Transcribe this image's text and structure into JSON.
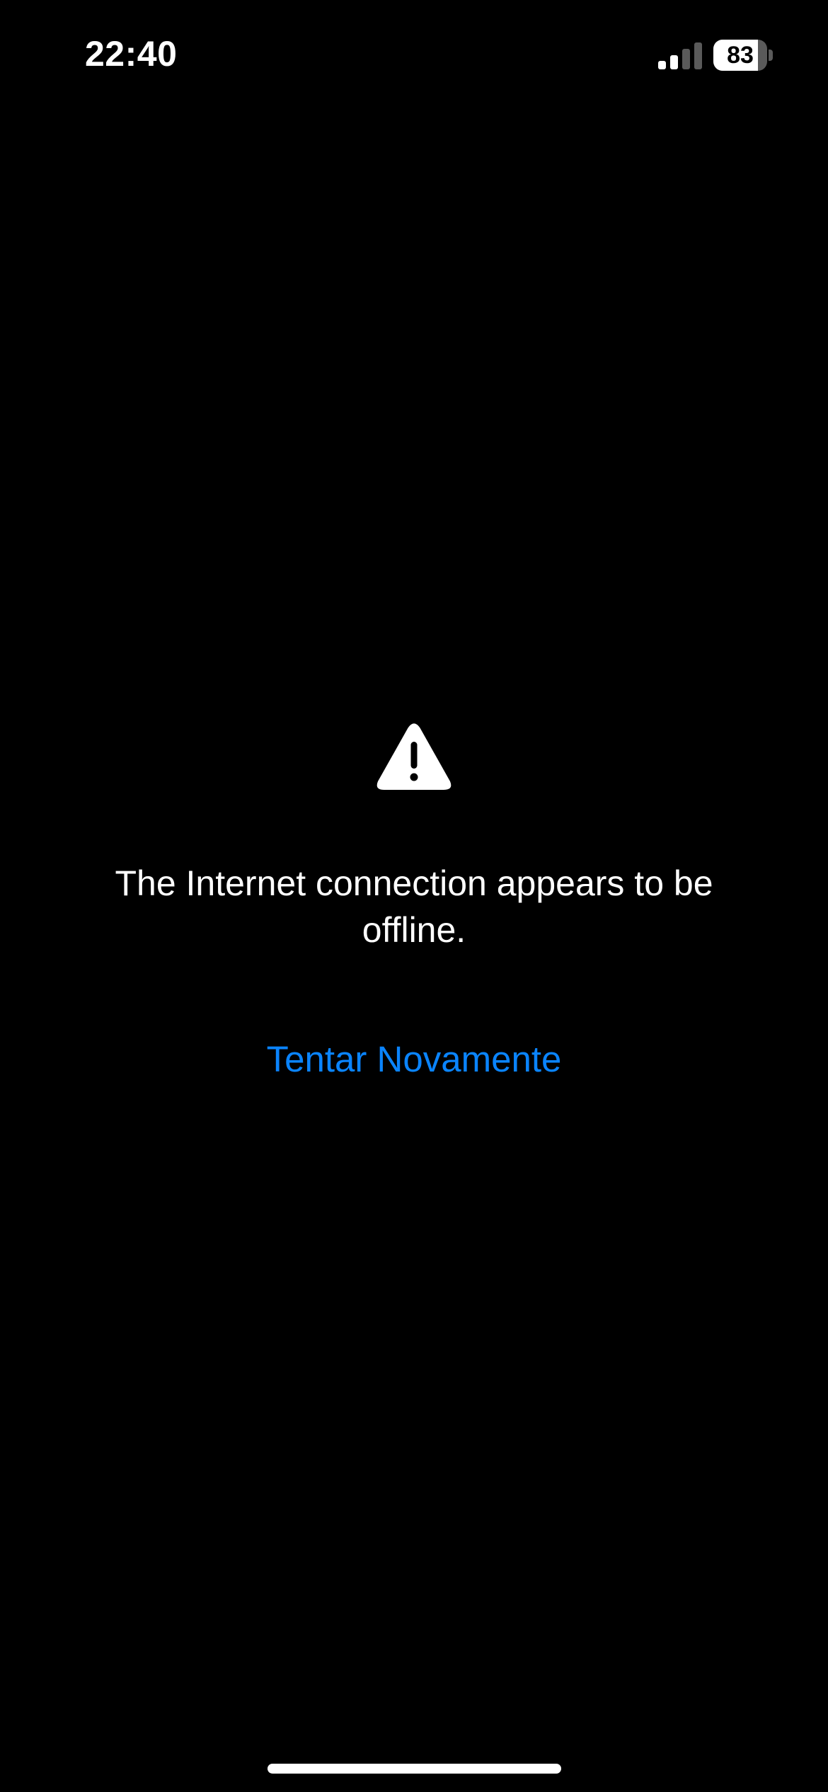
{
  "status_bar": {
    "time": "22:40",
    "signal_bars_active": 2,
    "signal_bars_total": 4,
    "battery_percent_label": "83",
    "battery_level": 0.83,
    "signal_active_color": "#ffffff",
    "signal_inactive_color": "#5a5a5a"
  },
  "main": {
    "icon": "warning-triangle-icon",
    "message": "The Internet connection appears to be offline.",
    "retry_label": "Tentar Novamente",
    "accent_color": "#0a84ff"
  }
}
